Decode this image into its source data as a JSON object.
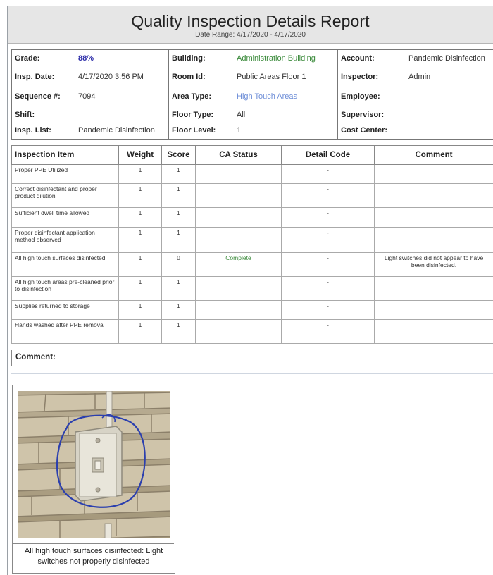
{
  "report": {
    "title": "Quality Inspection Details Report",
    "date_range": "Date Range: 4/17/2020 - 4/17/2020"
  },
  "info": {
    "col1": [
      {
        "label": "Grade:",
        "value": "88%"
      },
      {
        "label": "Insp. Date:",
        "value": "4/17/2020 3:56 PM"
      },
      {
        "label": "Sequence #:",
        "value": "7094"
      },
      {
        "label": "Shift:",
        "value": ""
      },
      {
        "label": "Insp. List:",
        "value": "Pandemic Disinfection"
      }
    ],
    "col2": [
      {
        "label": "Building:",
        "value": "Administration Building"
      },
      {
        "label": "Room Id:",
        "value": "Public Areas Floor 1"
      },
      {
        "label": "Area Type:",
        "value": "High Touch Areas"
      },
      {
        "label": "Floor Type:",
        "value": "All"
      },
      {
        "label": "Floor Level:",
        "value": "1"
      }
    ],
    "col3": [
      {
        "label": "Account:",
        "value": "Pandemic Disinfection"
      },
      {
        "label": "Inspector:",
        "value": "Admin"
      },
      {
        "label": "Employee:",
        "value": ""
      },
      {
        "label": "Supervisor:",
        "value": ""
      },
      {
        "label": "Cost Center:",
        "value": ""
      }
    ]
  },
  "table": {
    "headers": [
      "Inspection Item",
      "Weight",
      "Score",
      "CA Status",
      "Detail Code",
      "Comment"
    ],
    "rows": [
      {
        "item": "Proper PPE Utilized",
        "weight": "1",
        "score": "1",
        "status": "",
        "code": "-",
        "comment": ""
      },
      {
        "item": "Correct disinfectant and proper product dilution",
        "weight": "1",
        "score": "1",
        "status": "",
        "code": "-",
        "comment": ""
      },
      {
        "item": "Sufficient dwell time allowed",
        "weight": "1",
        "score": "1",
        "status": "",
        "code": "-",
        "comment": ""
      },
      {
        "item": "Proper disinfectant application method observed",
        "weight": "1",
        "score": "1",
        "status": "",
        "code": "-",
        "comment": ""
      },
      {
        "item": "All high touch surfaces disinfected",
        "weight": "1",
        "score": "0",
        "status": "Complete",
        "code": "-",
        "comment": "Light switches did not appear to have been disinfected."
      },
      {
        "item": "All high touch areas pre-cleaned prior to disinfection",
        "weight": "1",
        "score": "1",
        "status": "",
        "code": "-",
        "comment": ""
      },
      {
        "item": "Supplies returned to storage",
        "weight": "1",
        "score": "1",
        "status": "",
        "code": "-",
        "comment": ""
      },
      {
        "item": "Hands washed after PPE removal",
        "weight": "1",
        "score": "1",
        "status": "",
        "code": "-",
        "comment": ""
      }
    ]
  },
  "comment": {
    "label": "Comment:",
    "value": ""
  },
  "photo": {
    "caption": "All high touch surfaces disinfected: Light switches not properly disinfected"
  },
  "colors": {
    "grade": "#2a2aa8",
    "building": "#3a8a3a",
    "area_type": "#6f8fd8",
    "status": "#3a8a3a"
  }
}
